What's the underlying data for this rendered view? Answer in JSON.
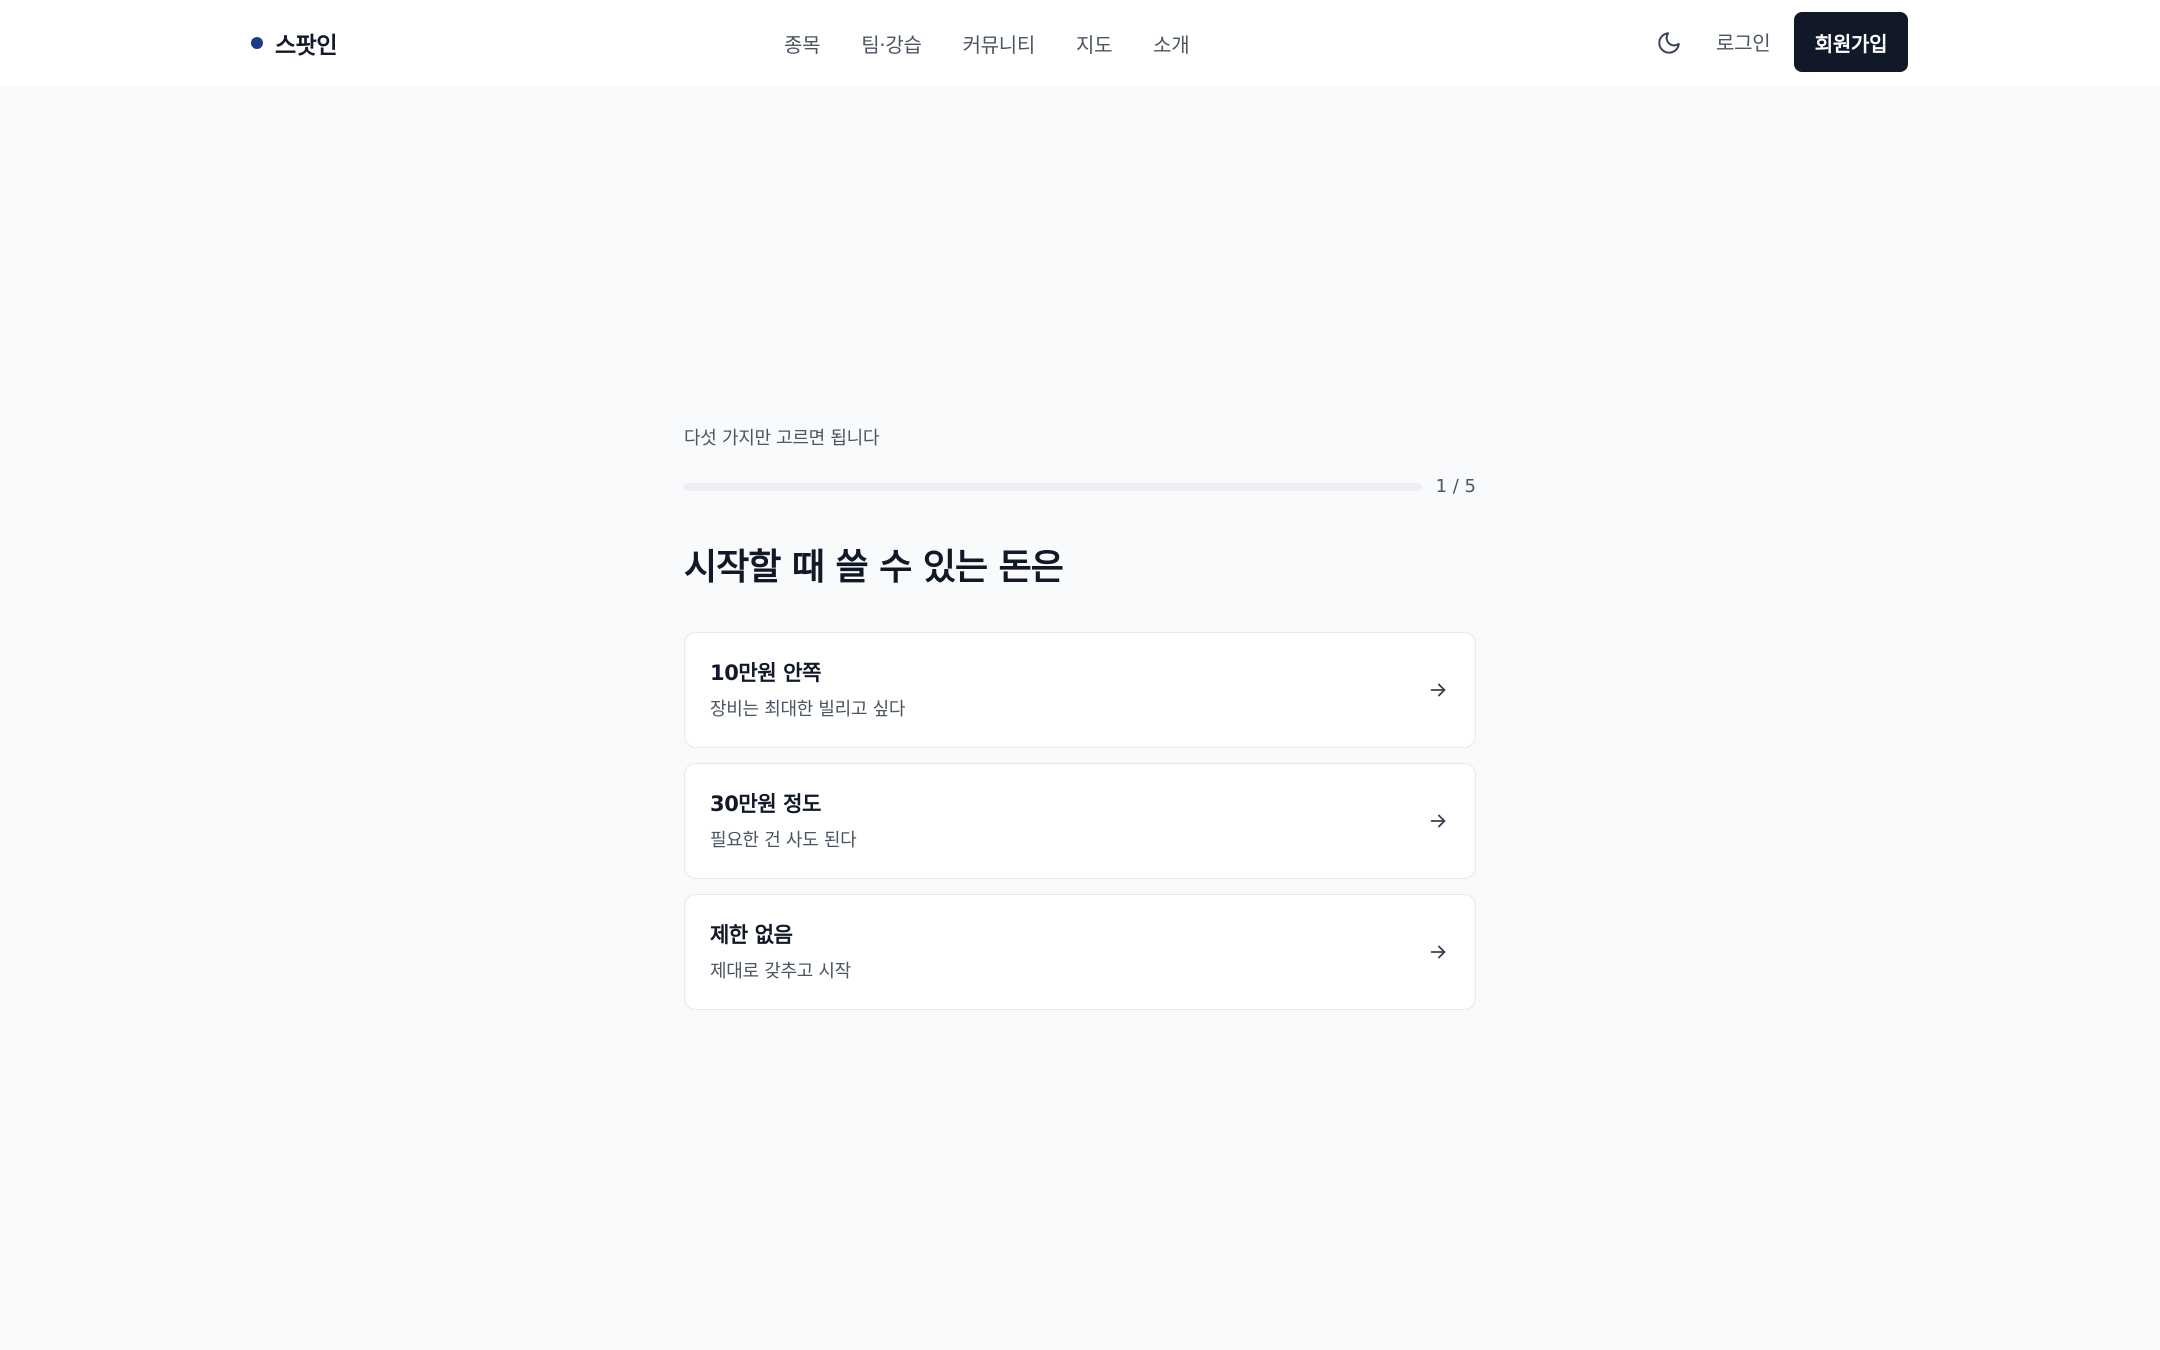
{
  "header": {
    "brand": "스팟인",
    "nav": [
      {
        "label": "종목"
      },
      {
        "label": "팀·강습"
      },
      {
        "label": "커뮤니티"
      },
      {
        "label": "지도"
      },
      {
        "label": "소개"
      }
    ],
    "theme_icon": "moon-icon",
    "login_label": "로그인",
    "signup_label": "회원가입"
  },
  "quiz": {
    "hint": "다섯 가지만 고르면 됩니다",
    "progress_text": "1 / 5",
    "progress_fraction": 0.2,
    "question": "시작할 때 쓸 수 있는 돈은",
    "options": [
      {
        "title": "10만원 안쪽",
        "description": "장비는 최대한 빌리고 싶다",
        "icon": "arrow-right-icon"
      },
      {
        "title": "30만원 정도",
        "description": "필요한 건 사도 된다",
        "icon": "arrow-right-icon"
      },
      {
        "title": "제한 없음",
        "description": "제대로 갖추고 시작",
        "icon": "arrow-right-icon"
      }
    ]
  },
  "colors": {
    "brand_dot": "#1e3a8a",
    "primary_button": "#111827",
    "page_background": "#f9fafb",
    "card_border": "#e5e7eb"
  }
}
